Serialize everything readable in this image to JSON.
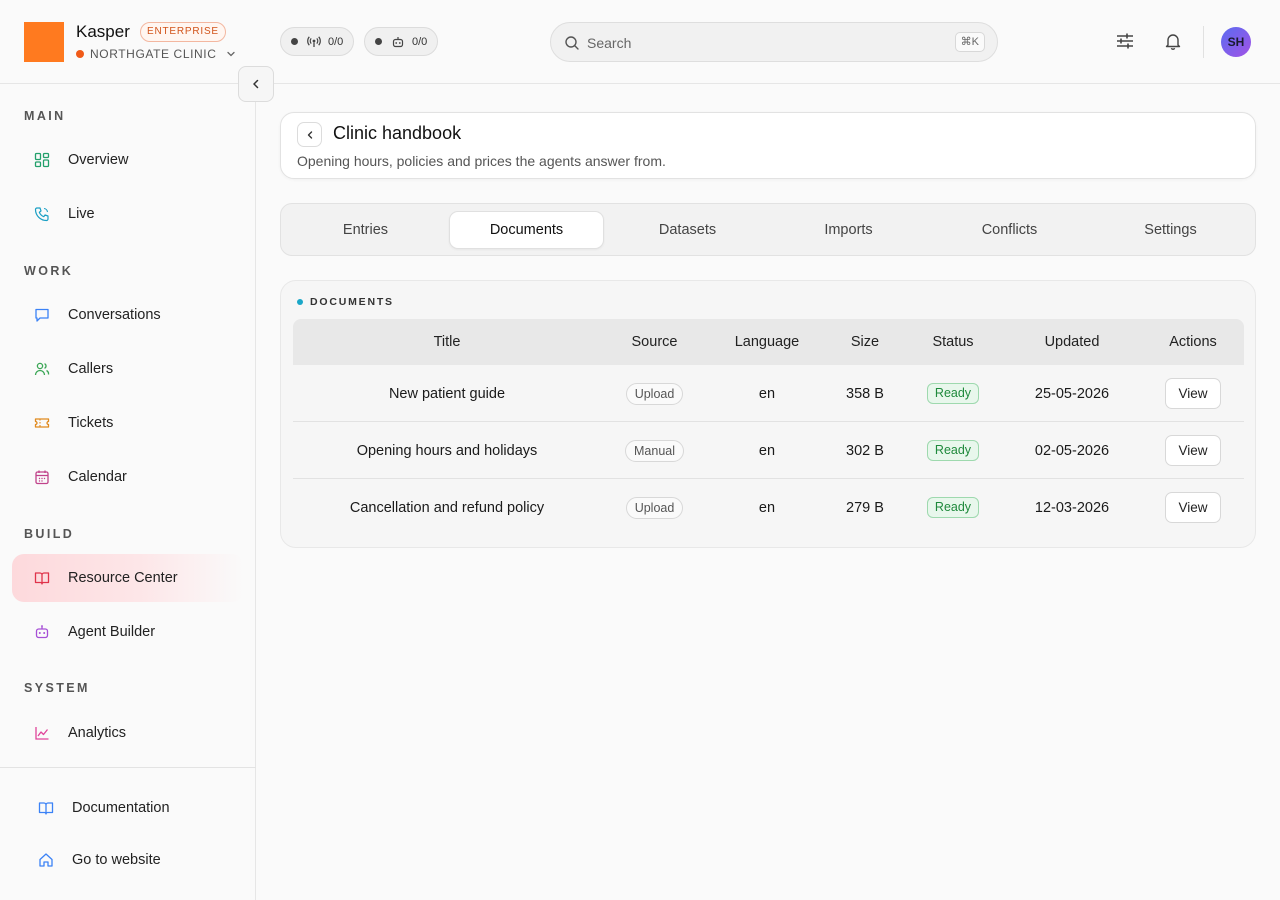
{
  "brand": {
    "name": "Kasper",
    "plan_badge": "ENTERPRISE",
    "org": "NORTHGATE CLINIC",
    "logo_color": "#ff7a1f"
  },
  "status_pills": [
    {
      "icon": "broadcast-icon",
      "value": "0/0"
    },
    {
      "icon": "robot-icon",
      "value": "0/0"
    }
  ],
  "search": {
    "placeholder": "Search",
    "shortcut": "⌘K"
  },
  "user": {
    "initials": "SH"
  },
  "sidebar": {
    "sections": [
      {
        "title": "MAIN",
        "items": [
          {
            "label": "Overview",
            "icon": "dashboard-icon",
            "color": "#22a06b"
          },
          {
            "label": "Live",
            "icon": "phone-icon",
            "color": "#1a9fc4"
          }
        ]
      },
      {
        "title": "WORK",
        "items": [
          {
            "label": "Conversations",
            "icon": "chat-icon",
            "color": "#3b82f6"
          },
          {
            "label": "Callers",
            "icon": "users-icon",
            "color": "#3aa655"
          },
          {
            "label": "Tickets",
            "icon": "ticket-icon",
            "color": "#e08a1e"
          },
          {
            "label": "Calendar",
            "icon": "calendar-icon",
            "color": "#c0428a"
          }
        ]
      },
      {
        "title": "BUILD",
        "items": [
          {
            "label": "Resource Center",
            "icon": "book-icon",
            "color": "#e0344b",
            "active": true
          },
          {
            "label": "Agent Builder",
            "icon": "robot-icon",
            "color": "#a64fd6"
          }
        ]
      },
      {
        "title": "SYSTEM",
        "items": [
          {
            "label": "Analytics",
            "icon": "chart-line-icon",
            "color": "#e0449a"
          }
        ]
      }
    ],
    "footer": [
      {
        "label": "Documentation",
        "icon": "book-open-icon",
        "color": "#3b82f6"
      },
      {
        "label": "Go to website",
        "icon": "home-icon",
        "color": "#3b82f6"
      }
    ]
  },
  "page": {
    "title": "Clinic handbook",
    "subtitle": "Opening hours, policies and prices the agents answer from."
  },
  "tabs": [
    {
      "label": "Entries"
    },
    {
      "label": "Documents",
      "active": true
    },
    {
      "label": "Datasets"
    },
    {
      "label": "Imports"
    },
    {
      "label": "Conflicts"
    },
    {
      "label": "Settings"
    }
  ],
  "documents": {
    "section_label": "DOCUMENTS",
    "columns": [
      "Title",
      "Source",
      "Language",
      "Size",
      "Status",
      "Updated",
      "Actions"
    ],
    "rows": [
      {
        "title": "New patient guide",
        "source": "Upload",
        "language": "en",
        "size": "358 B",
        "status": "Ready",
        "updated": "25-05-2026",
        "action": "View"
      },
      {
        "title": "Opening hours and holidays",
        "source": "Manual",
        "language": "en",
        "size": "302 B",
        "status": "Ready",
        "updated": "02-05-2026",
        "action": "View"
      },
      {
        "title": "Cancellation and refund policy",
        "source": "Upload",
        "language": "en",
        "size": "279 B",
        "status": "Ready",
        "updated": "12-03-2026",
        "action": "View"
      }
    ]
  },
  "colors": {
    "accent": "#ff7a1f",
    "ready_green": "#1f8a3c",
    "active_nav": "#fdd9dc"
  }
}
